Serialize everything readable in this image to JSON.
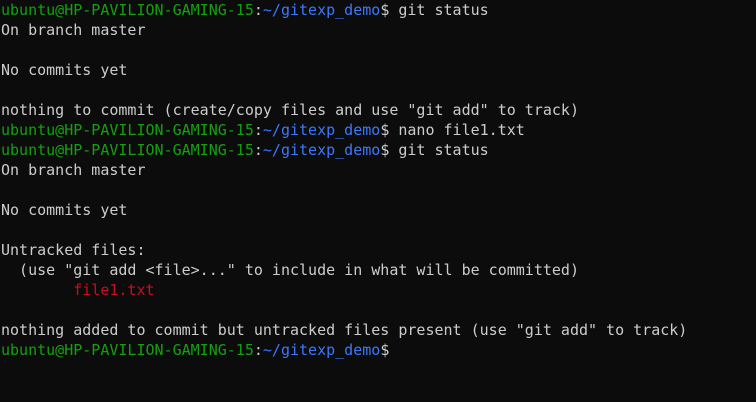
{
  "colors": {
    "background": "#0c0c0c",
    "text": "#cccccc",
    "user_host": "#13a10e",
    "path": "#3b78ff",
    "untracked_file": "#c50f1f"
  },
  "prompt": {
    "user_host": "ubuntu@HP-PAVILION-GAMING-15",
    "separator": ":",
    "path": "~/gitexp_demo",
    "symbol": "$"
  },
  "lines": [
    {
      "type": "prompt",
      "command": " git status"
    },
    {
      "type": "output",
      "text": "On branch master"
    },
    {
      "type": "output",
      "text": ""
    },
    {
      "type": "output",
      "text": "No commits yet"
    },
    {
      "type": "output",
      "text": ""
    },
    {
      "type": "output",
      "text": "nothing to commit (create/copy files and use \"git add\" to track)"
    },
    {
      "type": "prompt",
      "command": " nano file1.txt"
    },
    {
      "type": "prompt",
      "command": " git status"
    },
    {
      "type": "output",
      "text": "On branch master"
    },
    {
      "type": "output",
      "text": ""
    },
    {
      "type": "output",
      "text": "No commits yet"
    },
    {
      "type": "output",
      "text": ""
    },
    {
      "type": "output",
      "text": "Untracked files:"
    },
    {
      "type": "output",
      "text": "  (use \"git add <file>...\" to include in what will be committed)"
    },
    {
      "type": "untracked",
      "text": "        file1.txt"
    },
    {
      "type": "output",
      "text": ""
    },
    {
      "type": "output",
      "text": "nothing added to commit but untracked files present (use \"git add\" to track)"
    },
    {
      "type": "prompt",
      "command": ""
    }
  ]
}
